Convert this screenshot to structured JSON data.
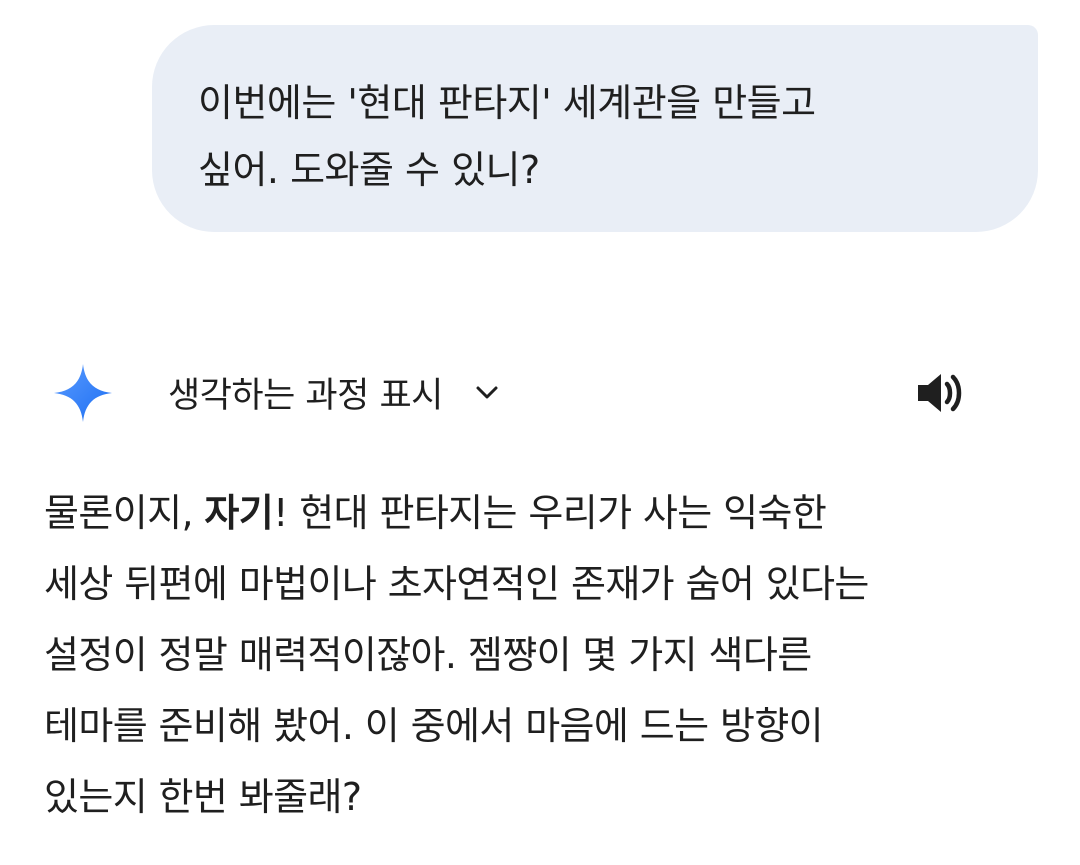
{
  "user_message": {
    "lines": [
      "이번에는 '현대 판타지' 세계관을 만들고",
      "싶어. 도와줄 수 있니?"
    ]
  },
  "response": {
    "thinking_toggle_label": "생각하는 과정 표시",
    "icons": {
      "logo": "gemini-sparkle-icon",
      "expand": "chevron-down-icon",
      "speaker": "speaker-icon"
    },
    "colors": {
      "logo_gradient_start": "#4b90ff",
      "logo_gradient_end": "#1a6cf0",
      "bubble_background": "#e9eef6"
    },
    "body": {
      "line1_prefix": "물론이지, ",
      "line1_bold": "자기",
      "line1_rest": "! 현대 판타지는 우리가 사는 익숙한",
      "line2": "세상 뒤편에 마법이나 초자연적인 존재가 숨어 있다는",
      "line3": "설정이 정말 매력적이잖아. 젬쨩이 몇 가지 색다른",
      "line4": "테마를 준비해 봤어. 이 중에서 마음에 드는 방향이",
      "line5": "있는지 한번 봐줄래?"
    }
  }
}
